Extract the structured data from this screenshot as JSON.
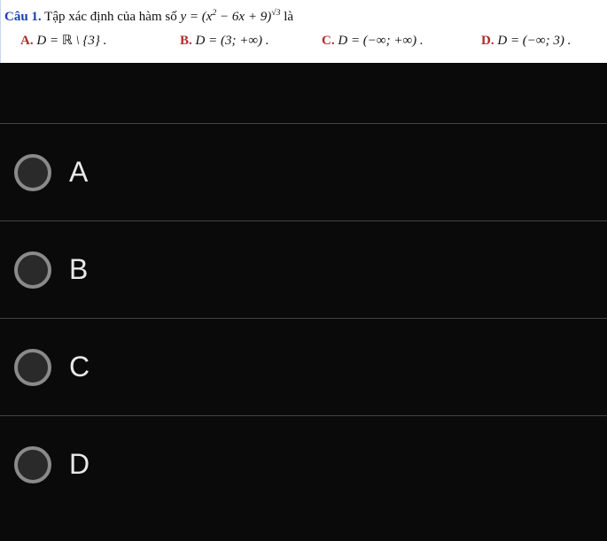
{
  "question": {
    "number_label": "Câu 1.",
    "prompt_before": " Tập xác định của hàm số ",
    "equation_html": "y = (x² − 6x + 9)<sup>√3</sup>",
    "prompt_after": " là",
    "options": {
      "A": {
        "label": "A.",
        "body_html": "D = ℝ \\ {3} ."
      },
      "B": {
        "label": "B.",
        "body_html": "D = (3; +∞) ."
      },
      "C": {
        "label": "C.",
        "body_html": "D = (−∞; +∞) ."
      },
      "D": {
        "label": "D.",
        "body_html": "D = (−∞; 3) ."
      }
    }
  },
  "choices": [
    {
      "key": "A",
      "label": "A"
    },
    {
      "key": "B",
      "label": "B"
    },
    {
      "key": "C",
      "label": "C"
    },
    {
      "key": "D",
      "label": "D"
    }
  ]
}
